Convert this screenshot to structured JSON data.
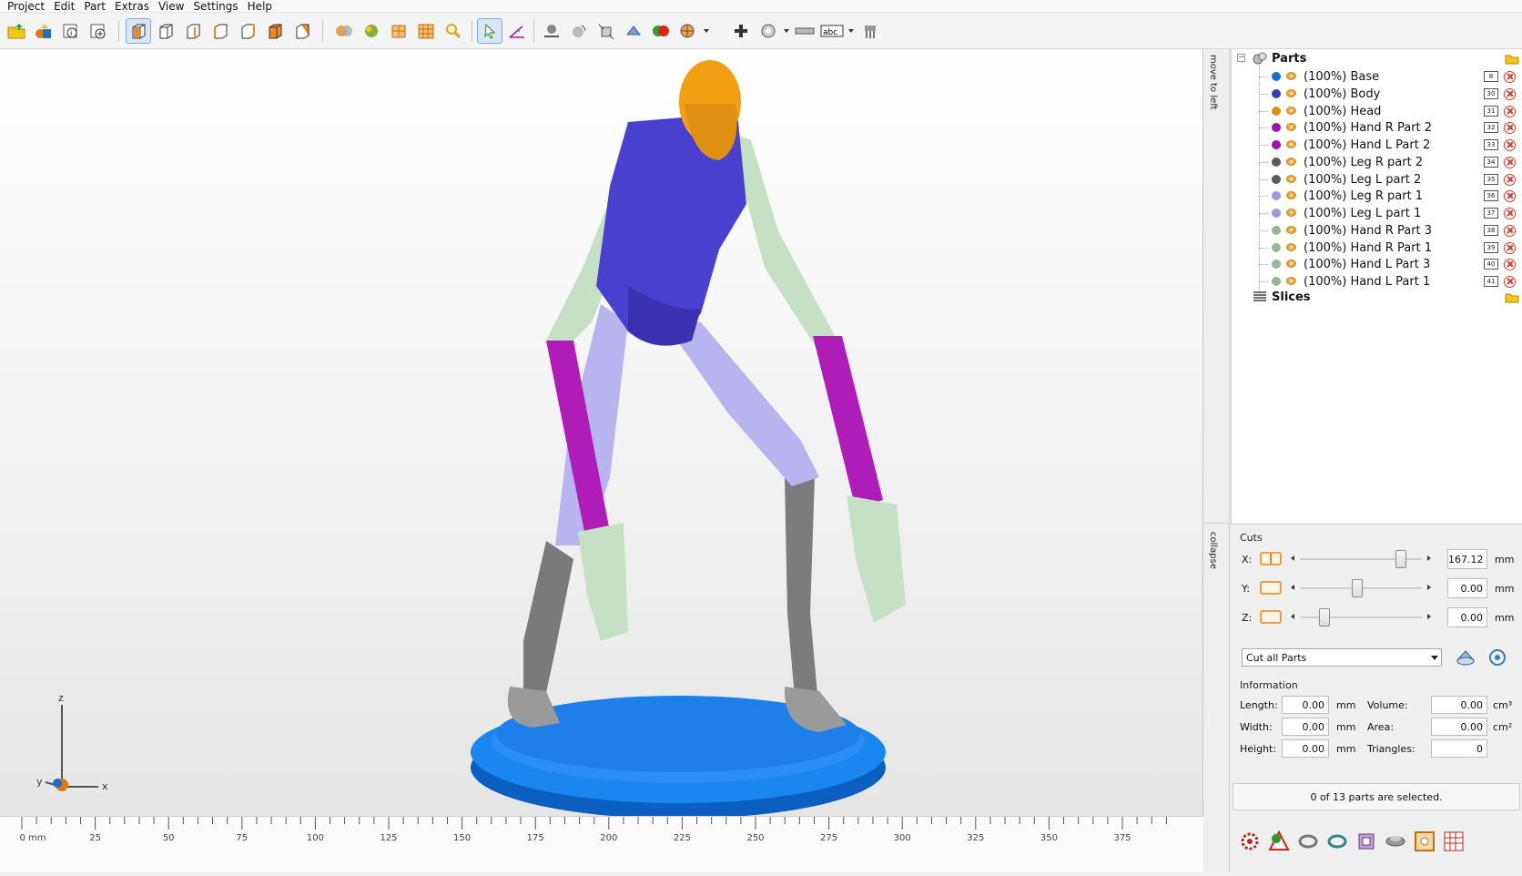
{
  "menu": [
    "Project",
    "Edit",
    "Part",
    "Extras",
    "View",
    "Settings",
    "Help"
  ],
  "toolbar": {
    "icons": [
      "open-folder",
      "add-parts",
      "project-info",
      "add-project",
      "view-iso",
      "view-front",
      "view-back",
      "view-left",
      "view-right",
      "view-top",
      "view-bottom",
      "shaded-mode",
      "color-mode",
      "wireframe-mode",
      "mesh-mode",
      "zoom",
      "select-tool",
      "measure-tool",
      "place-on-ground",
      "rotate",
      "scale",
      "move",
      "part-color",
      "render-style",
      "add",
      "transparency",
      "ruler",
      "text-label",
      "support"
    ]
  },
  "viewport": {
    "axis_labels": {
      "z": "z",
      "y": "y",
      "x": "x"
    },
    "ruler_labels": [
      "0 mm",
      "25",
      "50",
      "75",
      "100",
      "125",
      "150",
      "175",
      "200",
      "225",
      "250",
      "275",
      "300",
      "325",
      "350",
      "375"
    ]
  },
  "sidetabs": {
    "move": "move to left",
    "collapse": "collapse"
  },
  "tree": {
    "root_label": "Parts",
    "slices_label": "Slices",
    "parts": [
      {
        "label": "(100%) Base",
        "color": "#1a6fd1",
        "id": "8"
      },
      {
        "label": "(100%) Body",
        "color": "#3a3fb0",
        "id": "30"
      },
      {
        "label": "(100%) Head",
        "color": "#e08f10",
        "id": "31"
      },
      {
        "label": "(100%) Hand R Part 2",
        "color": "#a012a8",
        "id": "32"
      },
      {
        "label": "(100%) Hand L Part 2",
        "color": "#a012a8",
        "id": "33"
      },
      {
        "label": "(100%) Leg R part 2",
        "color": "#5a5a5a",
        "id": "34"
      },
      {
        "label": "(100%) Leg L part 2",
        "color": "#5a5a5a",
        "id": "35"
      },
      {
        "label": "(100%) Leg R part 1",
        "color": "#9a98e0",
        "id": "36"
      },
      {
        "label": "(100%) Leg L part 1",
        "color": "#9a98e0",
        "id": "37"
      },
      {
        "label": "(100%) Hand R Part 3",
        "color": "#9ab59a",
        "id": "38"
      },
      {
        "label": "(100%) Hand R Part 1",
        "color": "#9ab59a",
        "id": "39"
      },
      {
        "label": "(100%) Hand L Part 3",
        "color": "#9ab59a",
        "id": "40"
      },
      {
        "label": "(100%) Hand L Part 1",
        "color": "#9ab59a",
        "id": "41"
      }
    ]
  },
  "cuts": {
    "title": "Cuts",
    "x": {
      "label": "X:",
      "value": "167.12",
      "unit": "mm",
      "level": 0.86
    },
    "y": {
      "label": "Y:",
      "value": "0.00",
      "unit": "mm",
      "level": 0.47
    },
    "z": {
      "label": "Z:",
      "value": "0.00",
      "unit": "mm",
      "level": 0.17
    },
    "mode": "Cut all Parts"
  },
  "information": {
    "title": "Information",
    "length": {
      "label": "Length:",
      "value": "0.00",
      "unit": "mm"
    },
    "width": {
      "label": "Width:",
      "value": "0.00",
      "unit": "mm"
    },
    "height": {
      "label": "Height:",
      "value": "0.00",
      "unit": "mm"
    },
    "volume": {
      "label": "Volume:",
      "value": "0.00",
      "unit": "cm³"
    },
    "area": {
      "label": "Area:",
      "value": "0.00",
      "unit": "cm²"
    },
    "triangles": {
      "label": "Triangles:",
      "value": "0"
    }
  },
  "status": "0 of 13 parts are selected.",
  "bottom_icons": [
    "gear-icon",
    "warning-icon",
    "link-icon",
    "sync-icon",
    "cube-icon",
    "disk-icon",
    "square-icon",
    "grid-icon"
  ]
}
